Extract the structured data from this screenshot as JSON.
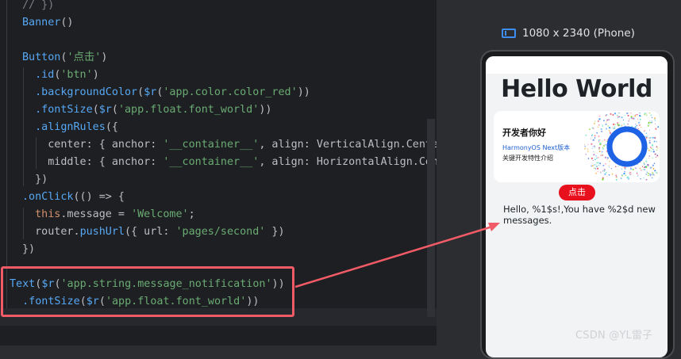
{
  "editor": {
    "lines": [
      {
        "parts": [
          {
            "t": "// })",
            "c": "cm"
          }
        ]
      },
      {
        "parts": [
          {
            "t": "Banner",
            "c": "fn"
          },
          {
            "t": "()",
            "c": "plain"
          }
        ]
      },
      {
        "parts": [
          {
            "t": "",
            "c": "plain"
          }
        ]
      },
      {
        "parts": [
          {
            "t": "Button",
            "c": "fn"
          },
          {
            "t": "(",
            "c": "plain"
          },
          {
            "t": "'点击'",
            "c": "str"
          },
          {
            "t": ")",
            "c": "plain"
          }
        ]
      },
      {
        "parts": [
          {
            "t": "  ",
            "c": "plain"
          },
          {
            "t": ".id",
            "c": "fn"
          },
          {
            "t": "(",
            "c": "plain"
          },
          {
            "t": "'btn'",
            "c": "str"
          },
          {
            "t": ")",
            "c": "plain"
          }
        ]
      },
      {
        "parts": [
          {
            "t": "  ",
            "c": "plain"
          },
          {
            "t": ".backgroundColor",
            "c": "fn"
          },
          {
            "t": "(",
            "c": "plain"
          },
          {
            "t": "$r",
            "c": "fn"
          },
          {
            "t": "(",
            "c": "plain"
          },
          {
            "t": "'app.color.color_red'",
            "c": "str"
          },
          {
            "t": "))",
            "c": "plain"
          }
        ]
      },
      {
        "parts": [
          {
            "t": "  ",
            "c": "plain"
          },
          {
            "t": ".fontSize",
            "c": "fn"
          },
          {
            "t": "(",
            "c": "plain"
          },
          {
            "t": "$r",
            "c": "fn"
          },
          {
            "t": "(",
            "c": "plain"
          },
          {
            "t": "'app.float.font_world'",
            "c": "str"
          },
          {
            "t": "))",
            "c": "plain"
          }
        ]
      },
      {
        "parts": [
          {
            "t": "  ",
            "c": "plain"
          },
          {
            "t": ".alignRules",
            "c": "fn"
          },
          {
            "t": "({",
            "c": "plain"
          }
        ]
      },
      {
        "parts": [
          {
            "t": "    center: { anchor: ",
            "c": "plain"
          },
          {
            "t": "'__container__'",
            "c": "str"
          },
          {
            "t": ", align: VerticalAlign.Center",
            "c": "plain"
          }
        ]
      },
      {
        "parts": [
          {
            "t": "    middle: { anchor: ",
            "c": "plain"
          },
          {
            "t": "'__container__'",
            "c": "str"
          },
          {
            "t": ", align: HorizontalAlign.Cent",
            "c": "plain"
          }
        ]
      },
      {
        "parts": [
          {
            "t": "  })",
            "c": "plain"
          }
        ]
      },
      {
        "parts": [
          {
            "t": ".onClick",
            "c": "fn"
          },
          {
            "t": "(() => {",
            "c": "plain"
          }
        ]
      },
      {
        "parts": [
          {
            "t": "  ",
            "c": "plain"
          },
          {
            "t": "this",
            "c": "kw"
          },
          {
            "t": ".message = ",
            "c": "plain"
          },
          {
            "t": "'Welcome'",
            "c": "str"
          },
          {
            "t": ";",
            "c": "plain"
          }
        ]
      },
      {
        "parts": [
          {
            "t": "  router.",
            "c": "plain"
          },
          {
            "t": "pushUrl",
            "c": "fn"
          },
          {
            "t": "({ url: ",
            "c": "plain"
          },
          {
            "t": "'pages/second'",
            "c": "str"
          },
          {
            "t": " })",
            "c": "plain"
          }
        ]
      },
      {
        "parts": [
          {
            "t": "})",
            "c": "plain"
          }
        ]
      },
      {
        "parts": [
          {
            "t": "",
            "c": "plain"
          }
        ]
      },
      {
        "parts": [
          {
            "t": "Text",
            "c": "fn"
          },
          {
            "t": "(",
            "c": "plain"
          },
          {
            "t": "$r",
            "c": "fn"
          },
          {
            "t": "(",
            "c": "plain"
          },
          {
            "t": "'app.string.message_notification'",
            "c": "str"
          },
          {
            "t": "))",
            "c": "plain"
          }
        ]
      },
      {
        "parts": [
          {
            "t": "  ",
            "c": "plain"
          },
          {
            "t": ".fontSize",
            "c": "fn"
          },
          {
            "t": "(",
            "c": "plain"
          },
          {
            "t": "$r",
            "c": "fn"
          },
          {
            "t": "(",
            "c": "plain"
          },
          {
            "t": "'app.float.font_world'",
            "c": "str"
          },
          {
            "t": "))",
            "c": "plain"
          }
        ]
      }
    ]
  },
  "preview": {
    "device_label": "1080 x 2340 (Phone)",
    "hello": "Hello World",
    "banner_title": "开发者你好",
    "banner_sub1": "HarmonyOS Next版本",
    "banner_sub2": "关键开发特性介绍",
    "button_label": "点击",
    "message": "Hello, %1$s!,You have %2$d new messages."
  },
  "watermark": "CSDN @YL雷子",
  "colors": {
    "highlight": "#f15b67",
    "button_red": "#e8101d",
    "device_icon": "#3d8ef0"
  }
}
